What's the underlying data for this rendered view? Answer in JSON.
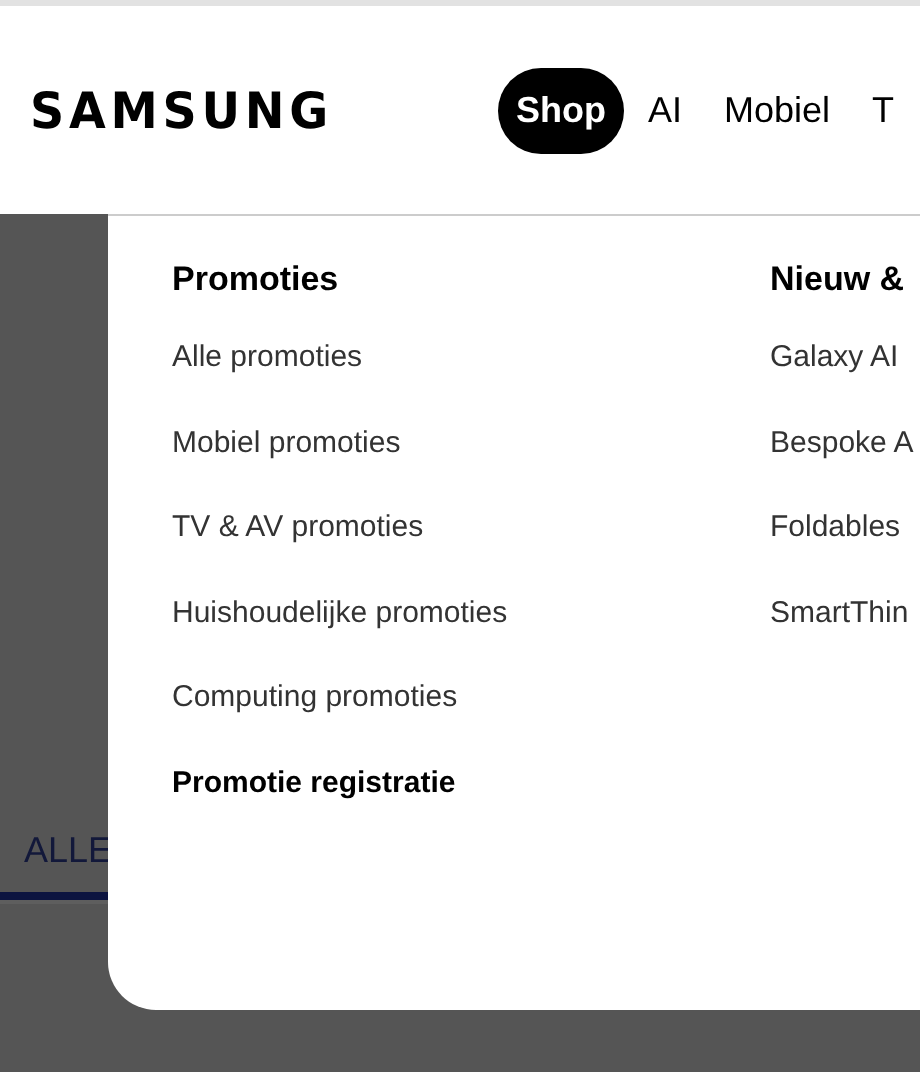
{
  "header": {
    "logo": "SAMSUNG",
    "nav": [
      {
        "label": "Shop",
        "selected": true
      },
      {
        "label": "AI",
        "selected": false
      },
      {
        "label": "Mobiel",
        "selected": false
      },
      {
        "label": "T",
        "selected": false
      }
    ]
  },
  "background_tabs": [
    {
      "label": "ALLE",
      "selected": true
    }
  ],
  "menu": {
    "columns": [
      {
        "heading": "Promoties",
        "items": [
          {
            "label": "Alle promoties",
            "emphasized": false
          },
          {
            "label": "Mobiel promoties",
            "emphasized": false
          },
          {
            "label": "TV & AV promoties",
            "emphasized": false
          },
          {
            "label": "Huishoudelijke promoties",
            "emphasized": false
          },
          {
            "label": "Computing promoties",
            "emphasized": false
          },
          {
            "label": "Promotie registratie",
            "emphasized": true
          }
        ]
      },
      {
        "heading": "Nieuw &",
        "items": [
          {
            "label": "Galaxy AI",
            "emphasized": false
          },
          {
            "label": "Bespoke A",
            "emphasized": false
          },
          {
            "label": "Foldables",
            "emphasized": false
          },
          {
            "label": "SmartThin",
            "emphasized": false
          }
        ]
      }
    ]
  }
}
